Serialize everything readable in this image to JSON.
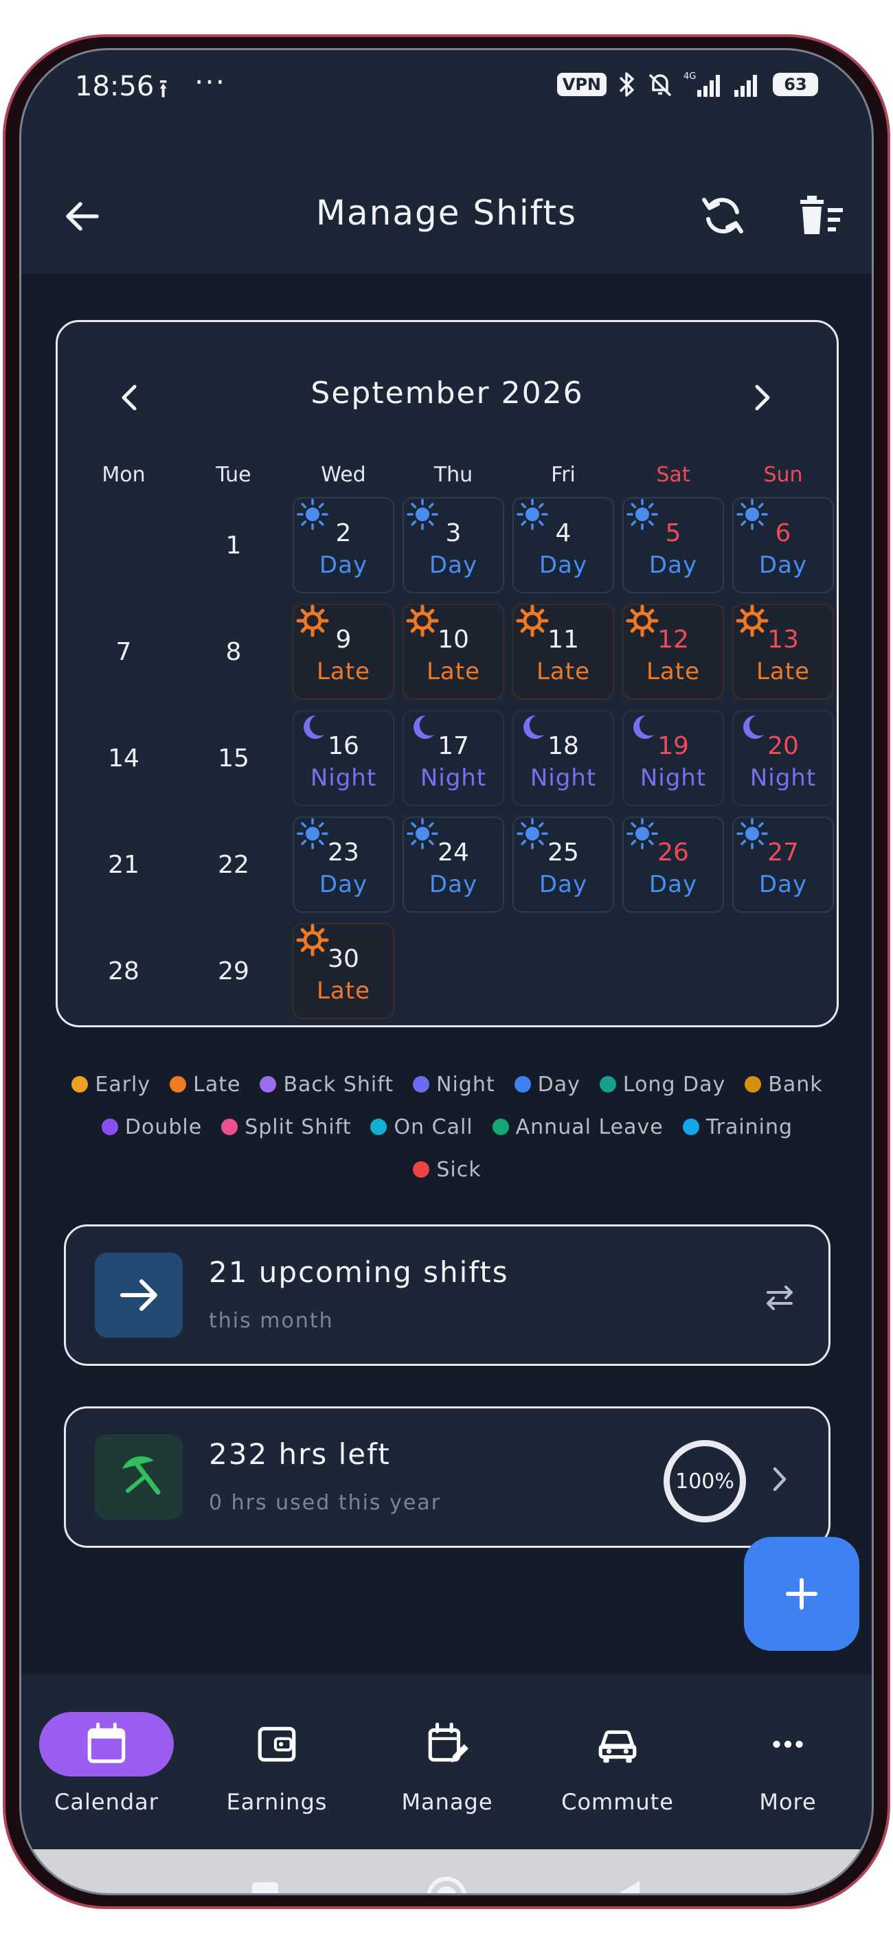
{
  "status": {
    "time": "18:56",
    "upload_glyph": "⭱",
    "dots": "···",
    "vpn": "VPN",
    "battery": "63"
  },
  "appbar": {
    "title": "Manage Shifts"
  },
  "calendar": {
    "title": "September 2026",
    "weekdays": [
      "Mon",
      "Tue",
      "Wed",
      "Thu",
      "Fri",
      "Sat",
      "Sun"
    ],
    "weeks": [
      [
        {
          "d": "",
          "s": ""
        },
        {
          "d": "1",
          "s": ""
        },
        {
          "d": "2",
          "s": "Day"
        },
        {
          "d": "3",
          "s": "Day"
        },
        {
          "d": "4",
          "s": "Day"
        },
        {
          "d": "5",
          "s": "Day"
        },
        {
          "d": "6",
          "s": "Day"
        }
      ],
      [
        {
          "d": "7",
          "s": ""
        },
        {
          "d": "8",
          "s": ""
        },
        {
          "d": "9",
          "s": "Late"
        },
        {
          "d": "10",
          "s": "Late"
        },
        {
          "d": "11",
          "s": "Late"
        },
        {
          "d": "12",
          "s": "Late"
        },
        {
          "d": "13",
          "s": "Late"
        }
      ],
      [
        {
          "d": "14",
          "s": ""
        },
        {
          "d": "15",
          "s": ""
        },
        {
          "d": "16",
          "s": "Night"
        },
        {
          "d": "17",
          "s": "Night"
        },
        {
          "d": "18",
          "s": "Night"
        },
        {
          "d": "19",
          "s": "Night"
        },
        {
          "d": "20",
          "s": "Night"
        }
      ],
      [
        {
          "d": "21",
          "s": ""
        },
        {
          "d": "22",
          "s": ""
        },
        {
          "d": "23",
          "s": "Day"
        },
        {
          "d": "24",
          "s": "Day"
        },
        {
          "d": "25",
          "s": "Day"
        },
        {
          "d": "26",
          "s": "Day"
        },
        {
          "d": "27",
          "s": "Day"
        }
      ],
      [
        {
          "d": "28",
          "s": ""
        },
        {
          "d": "29",
          "s": ""
        },
        {
          "d": "30",
          "s": "Late"
        },
        {
          "d": "",
          "s": ""
        },
        {
          "d": "",
          "s": ""
        },
        {
          "d": "",
          "s": ""
        },
        {
          "d": "",
          "s": ""
        }
      ]
    ]
  },
  "legend": [
    [
      {
        "label": "Early",
        "color": "#f0a020"
      },
      {
        "label": "Late",
        "color": "#f07a22"
      },
      {
        "label": "Back Shift",
        "color": "#9b6ef0"
      },
      {
        "label": "Night",
        "color": "#6c6cf0"
      },
      {
        "label": "Day",
        "color": "#3d82f0"
      },
      {
        "label": "Long Day",
        "color": "#14a08c"
      },
      {
        "label": "Bank",
        "color": "#d4900e"
      }
    ],
    [
      {
        "label": "Double",
        "color": "#8b4ef0"
      },
      {
        "label": "Split Shift",
        "color": "#ec4f90"
      },
      {
        "label": "On Call",
        "color": "#10b0d0"
      },
      {
        "label": "Annual Leave",
        "color": "#14a878"
      },
      {
        "label": "Training",
        "color": "#10a8e8"
      }
    ],
    [
      {
        "label": "Sick",
        "color": "#ef4444"
      }
    ]
  ],
  "upcoming_card": {
    "title": "21 upcoming shifts",
    "subtitle": "this month"
  },
  "hours_card": {
    "title": "232 hrs left",
    "subtitle": "0 hrs used this year",
    "percent": "100%"
  },
  "bottom_nav": [
    {
      "label": "Calendar",
      "icon": "calendar-icon",
      "active": true
    },
    {
      "label": "Earnings",
      "icon": "wallet-icon",
      "active": false
    },
    {
      "label": "Manage",
      "icon": "calendar-edit-icon",
      "active": false
    },
    {
      "label": "Commute",
      "icon": "car-icon",
      "active": false
    },
    {
      "label": "More",
      "icon": "more-icon",
      "active": false
    }
  ],
  "colors": {
    "accent": "#3d82f0",
    "active_nav": "#9b5cf0",
    "weekend": "#ef4a5a",
    "day": "#4a8cf0",
    "late": "#f07a22",
    "night": "#7b6ef0"
  }
}
